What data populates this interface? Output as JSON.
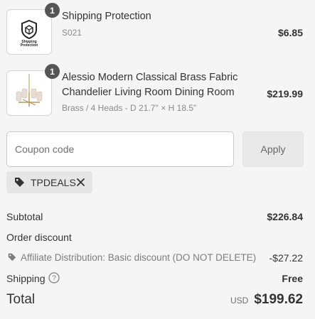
{
  "line_items": [
    {
      "quantity": "1",
      "title_line1": "Shipping Protection",
      "subtitle": "S021",
      "price": "$6.85",
      "thumb_text": [
        "Shipping",
        "Protection"
      ],
      "thumb_icon": "shield-cube-icon"
    },
    {
      "quantity": "1",
      "title_line1": "Alessio Modern Classical Brass Fabric",
      "title_line2": "Chandelier Living Room Dining Room",
      "subtitle": "Brass / 4 Heads - D 21.7'' × H 18.5\"",
      "price": "$219.99",
      "thumb_icon": "chandelier-image"
    }
  ],
  "coupon": {
    "placeholder": "Coupon code",
    "apply_label": "Apply",
    "applied_code": "TPDEALS"
  },
  "summary": {
    "subtotal_label": "Subtotal",
    "subtotal_value": "$226.84",
    "order_discount_label": "Order discount",
    "discount_name": "Affiliate Distribution: Basic discount (DO NOT DELETE)",
    "discount_value": "-$27.22",
    "shipping_label": "Shipping",
    "shipping_value": "Free",
    "total_label": "Total",
    "currency": "USD",
    "total_value": "$199.62"
  },
  "colors": {
    "background": "#f5f5f5",
    "badge": "#555555",
    "text": "#333333",
    "muted": "#8a8a8a"
  }
}
